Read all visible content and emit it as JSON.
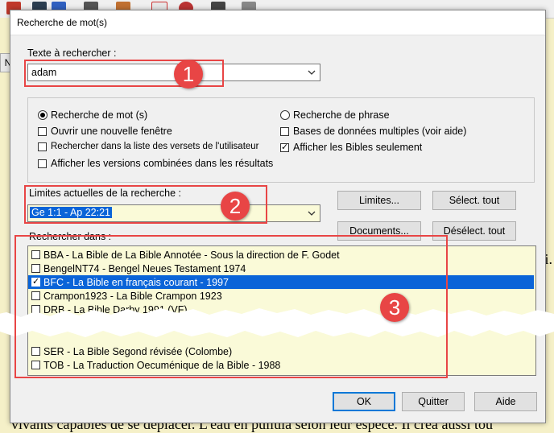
{
  "dialog": {
    "title": "Recherche de mot(s)",
    "search_label": "Texte à rechercher :",
    "search_value": "adam",
    "options": {
      "radio_word": "Recherche de mot (s)",
      "radio_phrase": "Recherche de phrase",
      "new_window": "Ouvrir une nouvelle fenêtre",
      "multiple_db": "Bases de données multiples (voir aide)",
      "user_verse_list": "Rechercher dans la liste des versets de l'utilisateur",
      "bibles_only": "Afficher les Bibles seulement",
      "combined_versions": "Afficher les versions combinées dans les résultats"
    },
    "limits_label": "Limites actuelles de la recherche :",
    "limits_value": "Ge 1:1 - Ap 22:21",
    "search_in_label": "Rechercher dans :",
    "buttons": {
      "limits": "Limites...",
      "select_all": "Sélect. tout",
      "documents": "Documents...",
      "deselect_all": "Désélect. tout",
      "ok": "OK",
      "quit": "Quitter",
      "help": "Aide"
    },
    "bibles": [
      {
        "label": "BBA - La Bible de La Bible Annotée - Sous la direction de F. Godet",
        "checked": false,
        "selected": false
      },
      {
        "label": "BengelNT74 - Bengel Neues Testament 1974",
        "checked": false,
        "selected": false
      },
      {
        "label": "BFC - La Bible en français courant - 1997",
        "checked": true,
        "selected": true
      },
      {
        "label": "Crampon1923 - La Bible Crampon 1923",
        "checked": false,
        "selected": false
      },
      {
        "label": "DRB - La Bible Darby 1991 (VF)",
        "checked": false,
        "selected": false
      },
      {
        "label": "SER - La Bible Segond révisée (Colombe)",
        "checked": false,
        "selected": false
      },
      {
        "label": "TOB - La Traduction Oecuménique de la Bible - 1988",
        "checked": false,
        "selected": false
      }
    ]
  },
  "annotations": {
    "badge1": "1",
    "badge2": "2",
    "badge3": "3"
  },
  "background": {
    "bottom_text": "vivants capables de se déplacer. L'eau en pullula selon leur espèce. Il créa aussi tou",
    "left_tab": "N"
  },
  "colors": {
    "callout": "#e84545",
    "selection": "#0a64d8",
    "list_bg": "#fafad8"
  }
}
